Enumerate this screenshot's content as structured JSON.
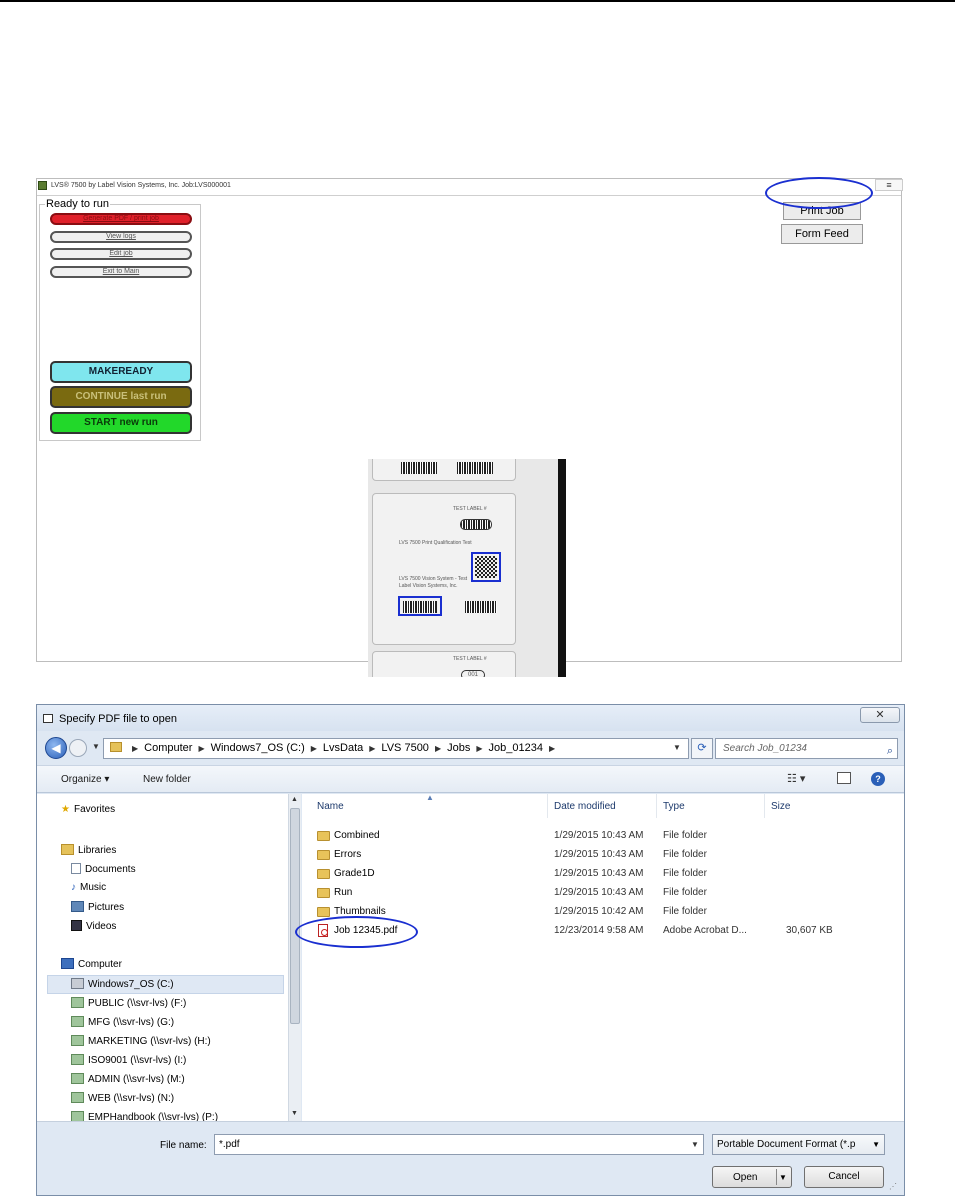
{
  "app": {
    "title": "LVS® 7500 by Label Vision Systems, Inc.   Job:LVS000001",
    "menu_glyph": "≡",
    "status": "Ready to run",
    "menu_buttons": [
      {
        "label": "Generate PDF / print job"
      },
      {
        "label": "View logs"
      },
      {
        "label": "Edit job"
      },
      {
        "label": "Exit to Main"
      }
    ],
    "run_buttons": {
      "makeready": "MAKEREADY",
      "continue": "CONTINUE last run",
      "start": "START new run"
    },
    "print_job": "Print Job",
    "form_feed": "Form Feed",
    "label_preview": {
      "label_top": "TEST LABEL #",
      "caption": "LVS 7500 Print Qualification Test",
      "side_text": "LVS 7500 Vision System - Test",
      "side_sub": "Label Vision Systems, Inc.",
      "label_bottom": "TEST LABEL #",
      "number": "001"
    },
    "colors": {
      "generate_btn": "#e0202a",
      "makeready_btn": "#7fe6ee",
      "continue_btn": "#7a6a10",
      "start_btn": "#22d82a",
      "highlight": "#1a2fd0"
    }
  },
  "dialog": {
    "title": "Specify PDF file to open",
    "close_glyph": "✕",
    "breadcrumb": [
      "Computer",
      "Windows7_OS (C:)",
      "LvsData",
      "LVS 7500",
      "Jobs",
      "Job_01234"
    ],
    "search_placeholder": "Search Job_01234",
    "toolbar": {
      "organize": "Organize ▾",
      "new_folder": "New folder",
      "views_glyph": "☷ ▾",
      "help_glyph": "?"
    },
    "nav": {
      "favorites": "Favorites",
      "libraries": "Libraries",
      "library_items": [
        "Documents",
        "Music",
        "Pictures",
        "Videos"
      ],
      "computer": "Computer",
      "drives": [
        "Windows7_OS (C:)",
        "PUBLIC (\\\\svr-lvs) (F:)",
        "MFG (\\\\svr-lvs) (G:)",
        "MARKETING (\\\\svr-lvs) (H:)",
        "ISO9001 (\\\\svr-lvs) (I:)",
        "ADMIN (\\\\svr-lvs) (M:)",
        "WEB (\\\\svr-lvs) (N:)",
        "EMPHandbook (\\\\svr-lvs) (P:)"
      ],
      "selected": "Windows7_OS (C:)"
    },
    "columns": {
      "name": "Name",
      "date": "Date modified",
      "type": "Type",
      "size": "Size"
    },
    "files": [
      {
        "name": "Combined",
        "date": "1/29/2015 10:43 AM",
        "type": "File folder",
        "size": "",
        "icon": "folder-icon"
      },
      {
        "name": "Errors",
        "date": "1/29/2015 10:43 AM",
        "type": "File folder",
        "size": "",
        "icon": "folder-icon"
      },
      {
        "name": "Grade1D",
        "date": "1/29/2015 10:43 AM",
        "type": "File folder",
        "size": "",
        "icon": "folder-icon"
      },
      {
        "name": "Run",
        "date": "1/29/2015 10:43 AM",
        "type": "File folder",
        "size": "",
        "icon": "folder-icon"
      },
      {
        "name": "Thumbnails",
        "date": "1/29/2015 10:42 AM",
        "type": "File folder",
        "size": "",
        "icon": "folder-icon"
      },
      {
        "name": "Job 12345.pdf",
        "date": "12/23/2014 9:58 AM",
        "type": "Adobe Acrobat D...",
        "size": "30,607 KB",
        "icon": "pdf-icon"
      }
    ],
    "file_name_label": "File name:",
    "file_name_value": "*.pdf",
    "file_type": "Portable Document Format (*.p",
    "open_label": "Open",
    "cancel_label": "Cancel"
  }
}
